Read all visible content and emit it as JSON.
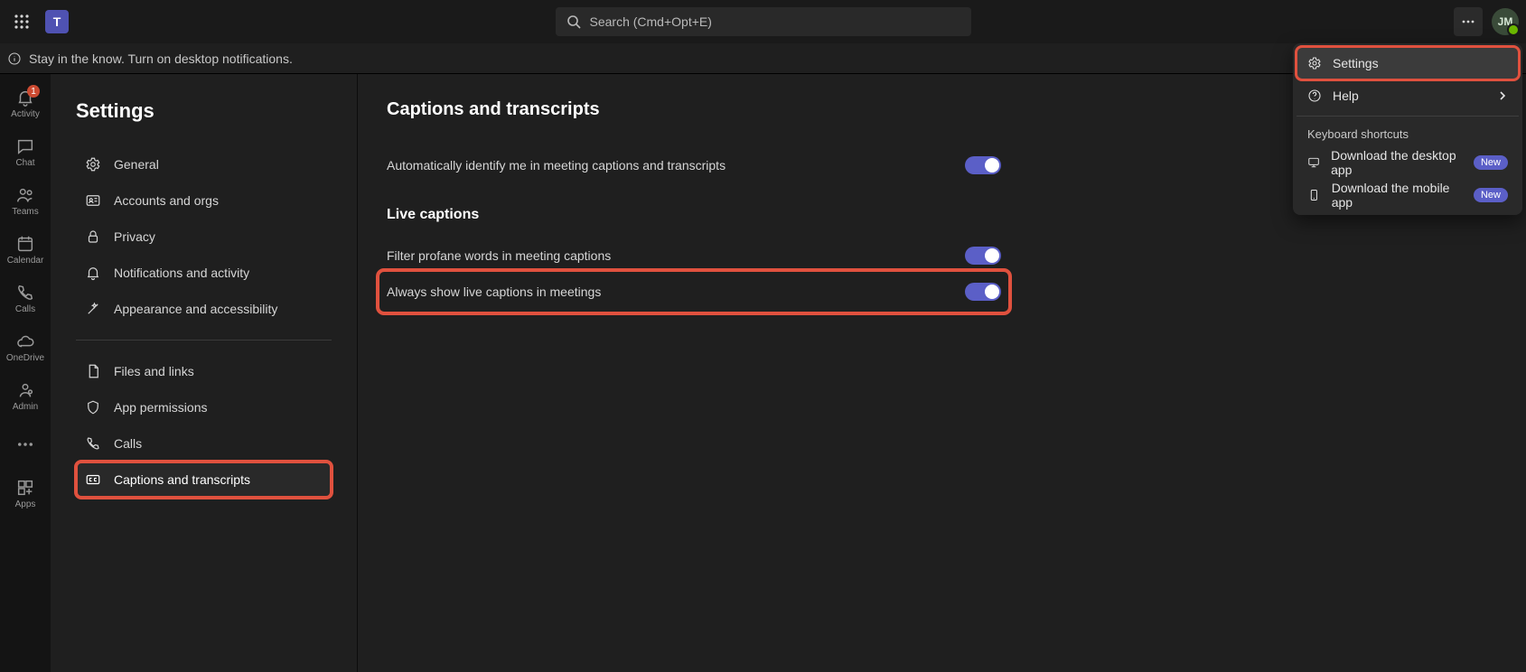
{
  "topbar": {
    "search_placeholder": "Search (Cmd+Opt+E)",
    "avatar_initials": "JM"
  },
  "notification": {
    "text": "Stay in the know. Turn on desktop notifications."
  },
  "rail": {
    "items": [
      {
        "label": "Activity",
        "badge": "1"
      },
      {
        "label": "Chat"
      },
      {
        "label": "Teams"
      },
      {
        "label": "Calendar"
      },
      {
        "label": "Calls"
      },
      {
        "label": "OneDrive"
      },
      {
        "label": "Admin"
      }
    ],
    "apps_label": "Apps"
  },
  "settings": {
    "title": "Settings",
    "items": {
      "general": "General",
      "accounts": "Accounts and orgs",
      "privacy": "Privacy",
      "notifications": "Notifications and activity",
      "appearance": "Appearance and accessibility",
      "files": "Files and links",
      "permissions": "App permissions",
      "calls": "Calls",
      "captions": "Captions and transcripts"
    }
  },
  "content": {
    "title": "Captions and transcripts",
    "auto_identify": "Automatically identify me in meeting captions and transcripts",
    "live_heading": "Live captions",
    "filter_profane": "Filter profane words in meeting captions",
    "always_show": "Always show live captions in meetings"
  },
  "menu": {
    "settings": "Settings",
    "help": "Help",
    "shortcuts": "Keyboard shortcuts",
    "desktop": "Download the desktop app",
    "mobile": "Download the mobile app",
    "new_pill": "New"
  }
}
